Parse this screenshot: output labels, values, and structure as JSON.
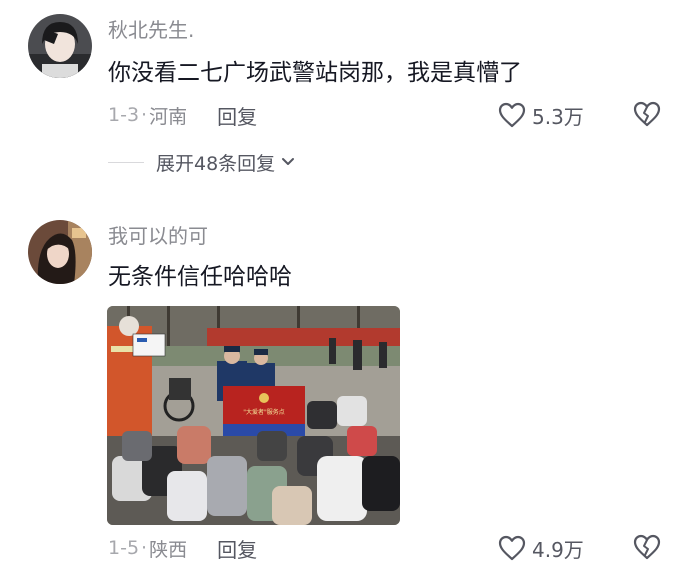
{
  "comments": [
    {
      "username": "秋北先生.",
      "text": "你没看二七广场武警站岗那，我是真懵了",
      "date": "1-3",
      "separator": "·",
      "region": "河南",
      "reply_label": "回复",
      "likes": "5.3万",
      "expand_label": "展开48条回复"
    },
    {
      "username": "我可以的可",
      "text": "无条件信任哈哈哈",
      "date": "1-5",
      "separator": "·",
      "region": "陕西",
      "reply_label": "回复",
      "likes": "4.9万",
      "photo_sign_text": "\"大爱者\"服务点"
    }
  ],
  "icons": {
    "like": "heart-outline-icon",
    "dislike": "broken-heart-icon",
    "expand": "chevron-down-icon"
  },
  "colors": {
    "primary_text": "#161823",
    "secondary_text": "#8a8b91",
    "action_text": "#555761"
  }
}
